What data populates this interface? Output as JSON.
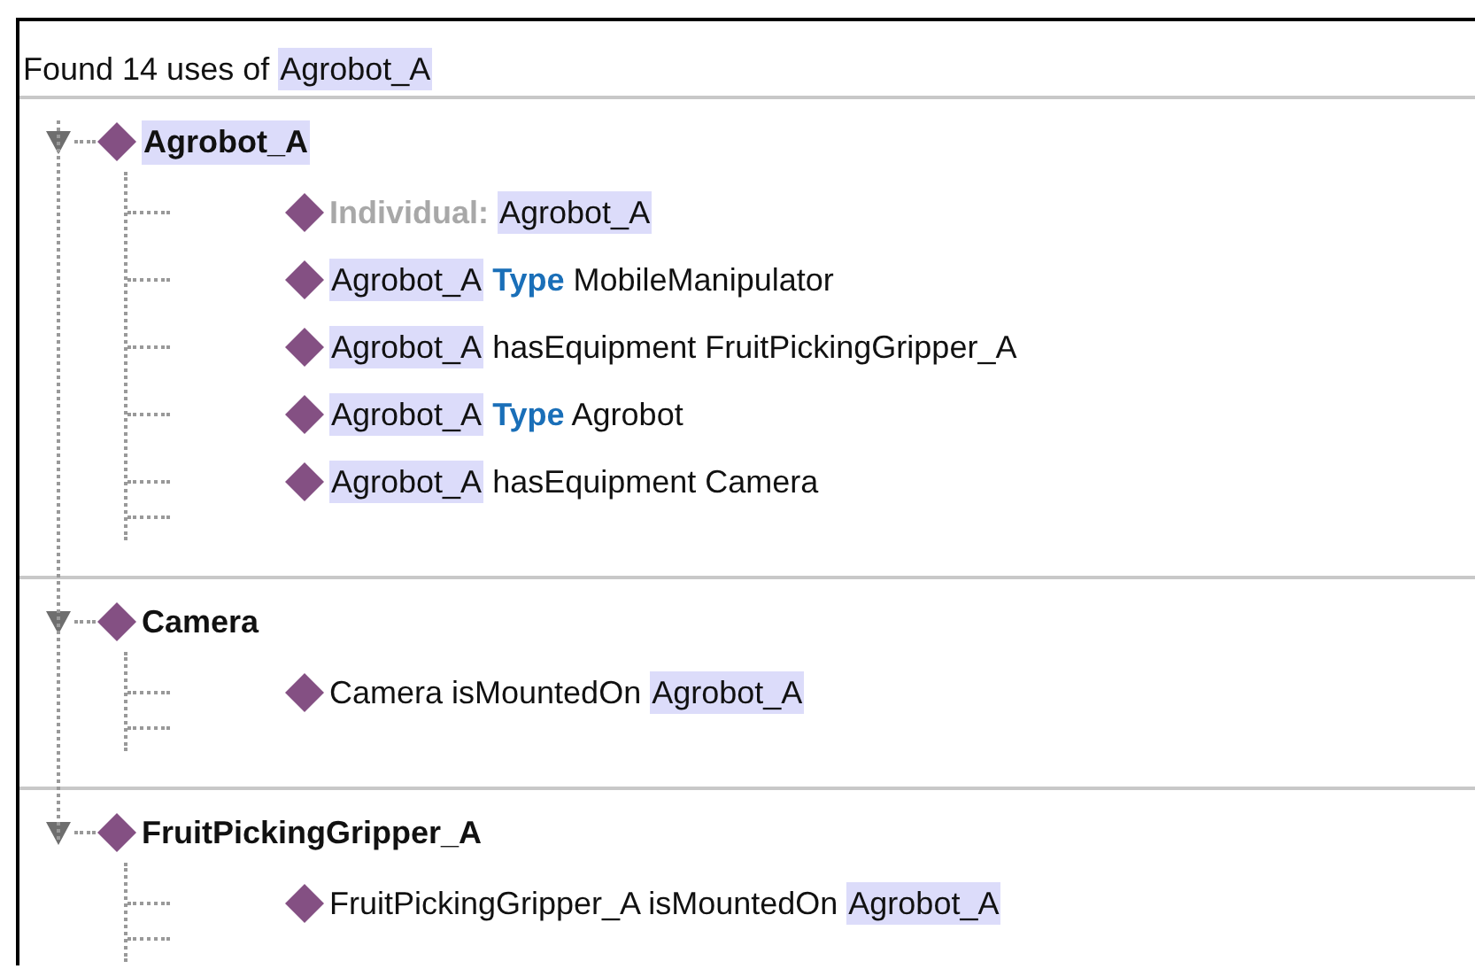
{
  "header": [
    {
      "text": "Found 14 uses of",
      "kind": "plain"
    },
    {
      "text": "Agrobot_A",
      "kind": "match"
    }
  ],
  "groups": [
    {
      "title": "Agrobot_A",
      "highlighted": true,
      "expanded": true,
      "children": [
        [
          {
            "text": "Individual:",
            "kind": "label"
          },
          {
            "text": "Agrobot_A",
            "kind": "match"
          }
        ],
        [
          {
            "text": "Agrobot_A",
            "kind": "match"
          },
          {
            "text": "Type",
            "kind": "keyword"
          },
          {
            "text": "MobileManipulator",
            "kind": "plain"
          }
        ],
        [
          {
            "text": "Agrobot_A",
            "kind": "match"
          },
          {
            "text": "hasEquipment FruitPickingGripper_A",
            "kind": "plain"
          }
        ],
        [
          {
            "text": "Agrobot_A",
            "kind": "match"
          },
          {
            "text": "Type",
            "kind": "keyword"
          },
          {
            "text": "Agrobot",
            "kind": "plain"
          }
        ],
        [
          {
            "text": "Agrobot_A",
            "kind": "match"
          },
          {
            "text": "hasEquipment Camera",
            "kind": "plain"
          }
        ]
      ]
    },
    {
      "title": "Camera",
      "highlighted": false,
      "expanded": true,
      "children": [
        [
          {
            "text": "Camera isMountedOn",
            "kind": "plain"
          },
          {
            "text": "Agrobot_A",
            "kind": "match"
          }
        ]
      ]
    },
    {
      "title": "FruitPickingGripper_A",
      "highlighted": false,
      "expanded": true,
      "children": [
        [
          {
            "text": "FruitPickingGripper_A isMountedOn",
            "kind": "plain"
          },
          {
            "text": "Agrobot_A",
            "kind": "match"
          }
        ]
      ]
    }
  ]
}
